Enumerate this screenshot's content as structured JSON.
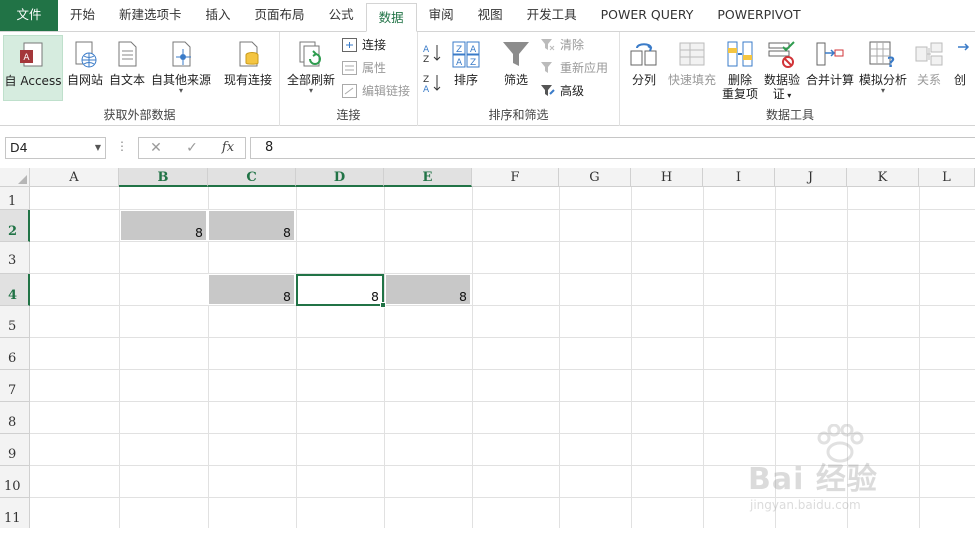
{
  "tabs": [
    {
      "label": "文件"
    },
    {
      "label": "开始"
    },
    {
      "label": "新建选项卡"
    },
    {
      "label": "插入"
    },
    {
      "label": "页面布局"
    },
    {
      "label": "公式"
    },
    {
      "label": "数据"
    },
    {
      "label": "审阅"
    },
    {
      "label": "视图"
    },
    {
      "label": "开发工具"
    },
    {
      "label": "POWER QUERY"
    },
    {
      "label": "POWERPIVOT"
    }
  ],
  "active_tab": "数据",
  "ribbon": {
    "external": {
      "label": "获取外部数据",
      "access": "自 Access",
      "web": "自网站",
      "text": "自文本",
      "other": "自其他来源",
      "existing": "现有连接"
    },
    "connections": {
      "label": "连接",
      "refresh_all": "全部刷新",
      "connections": "连接",
      "properties": "属性",
      "edit_links": "编辑链接"
    },
    "sort_filter": {
      "label": "排序和筛选",
      "sort": "排序",
      "filter": "筛选",
      "clear": "清除",
      "reapply": "重新应用",
      "advanced": "高级"
    },
    "data_tools": {
      "label": "数据工具",
      "text_to_columns": "分列",
      "flash_fill": "快速填充",
      "remove_dup_1": "删除",
      "remove_dup_2": "重复项",
      "validation_1": "数据验",
      "validation_2": "证",
      "consolidate": "合并计算",
      "what_if": "模拟分析",
      "relationships": "关系",
      "create": "创"
    }
  },
  "formula_bar": {
    "name_box": "D4",
    "cancel_symbol": "✕",
    "enter_symbol": "✓",
    "fx_symbol": "fx",
    "value": "8"
  },
  "columns": [
    "A",
    "B",
    "C",
    "D",
    "E",
    "F",
    "G",
    "H",
    "I",
    "J",
    "K",
    "L"
  ],
  "rows": [
    "1",
    "2",
    "3",
    "4",
    "5",
    "6",
    "7",
    "8",
    "9",
    "10",
    "11"
  ],
  "selected_cell": "D4",
  "cells": {
    "B2": "8",
    "C2": "8",
    "C4": "8",
    "D4": "8",
    "E4": "8"
  },
  "colors": {
    "accent": "#217346",
    "filled_cell": "#c8c8c8"
  },
  "watermark": {
    "text": "Bai 经验",
    "url": "jingyan.baidu.com"
  }
}
